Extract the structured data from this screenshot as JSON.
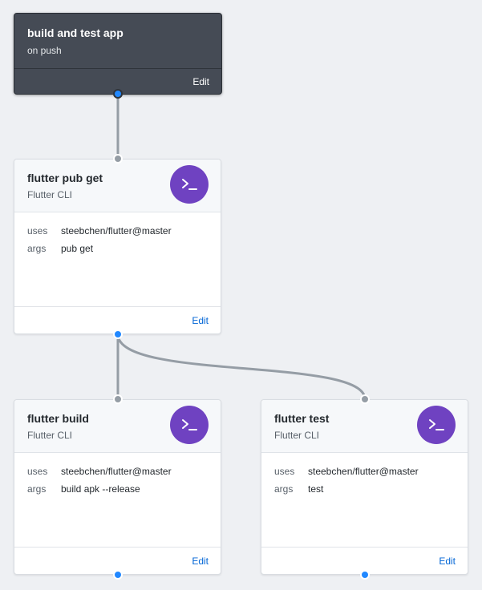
{
  "workflow": {
    "title": "build and test app",
    "trigger": "on push",
    "edit_label": "Edit"
  },
  "actions": [
    {
      "title": "flutter pub get",
      "subtitle": "Flutter CLI",
      "icon": "terminal-icon",
      "fields": [
        {
          "key": "uses",
          "value": "steebchen/flutter@master"
        },
        {
          "key": "args",
          "value": "pub get"
        }
      ],
      "edit_label": "Edit"
    },
    {
      "title": "flutter build",
      "subtitle": "Flutter CLI",
      "icon": "terminal-icon",
      "fields": [
        {
          "key": "uses",
          "value": "steebchen/flutter@master"
        },
        {
          "key": "args",
          "value": "build apk --release"
        }
      ],
      "edit_label": "Edit"
    },
    {
      "title": "flutter test",
      "subtitle": "Flutter CLI",
      "icon": "terminal-icon",
      "fields": [
        {
          "key": "uses",
          "value": "steebchen/flutter@master"
        },
        {
          "key": "args",
          "value": "test"
        }
      ],
      "edit_label": "Edit"
    }
  ],
  "colors": {
    "canvas": "#eef0f3",
    "trigger_card": "#454b55",
    "action_icon": "#6f42c1",
    "output_port": "#2188ff",
    "input_port": "#959da5",
    "edge": "#959da5",
    "link": "#0366d6"
  }
}
